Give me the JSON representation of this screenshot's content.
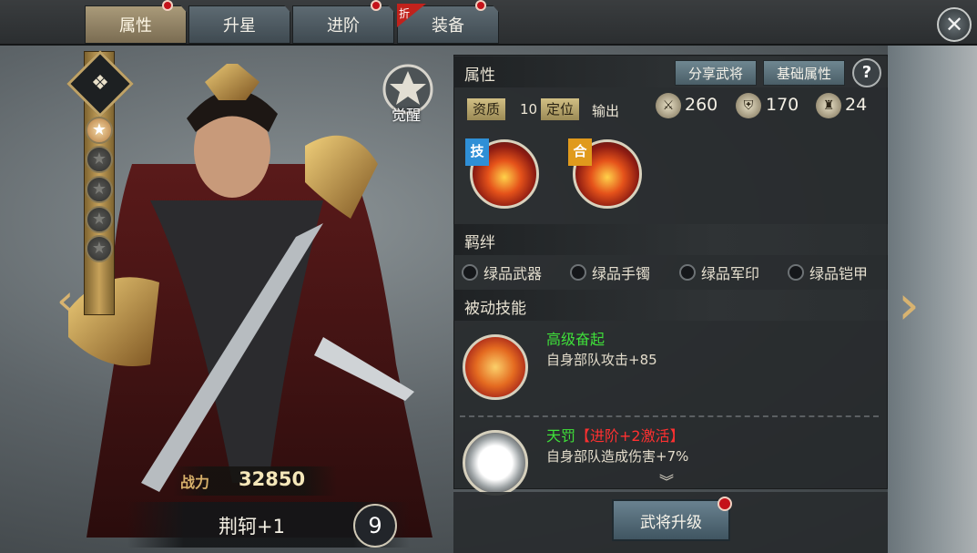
{
  "tabs": [
    {
      "label": "属性",
      "active": true,
      "has_alert": true
    },
    {
      "label": "升星",
      "active": false,
      "has_alert": false
    },
    {
      "label": "进阶",
      "active": false,
      "has_alert": true
    },
    {
      "label": "装备",
      "active": false,
      "has_alert": true,
      "sale_flag": "折"
    }
  ],
  "close_icon": "✕",
  "hero": {
    "awaken_label": "觉醒",
    "power_label": "战力",
    "power_value": "32850",
    "name": "荆轲+1",
    "level": "9",
    "stars_total": 5,
    "stars_lit": 1
  },
  "panel": {
    "attributes_title": "属性",
    "share_button": "分享武将",
    "base_attr_button": "基础属性",
    "help_button": "?",
    "aptitude_tag": "资质",
    "aptitude_value": "10",
    "position_tag": "定位",
    "position_value": "输出",
    "stats": [
      {
        "icon": "attack-icon",
        "value": "260"
      },
      {
        "icon": "defense-icon",
        "value": "170"
      },
      {
        "icon": "troops-icon",
        "value": "24"
      }
    ],
    "skills": [
      {
        "tag": "技",
        "tag_color": "#2f8fd6"
      },
      {
        "tag": "合",
        "tag_color": "#e09a1c"
      }
    ],
    "bonds_title": "羁绊",
    "bonds": [
      "绿品武器",
      "绿品手镯",
      "绿品军印",
      "绿品铠甲"
    ],
    "passive_title": "被动技能",
    "passives": [
      {
        "name": "高级奋起",
        "name_color": "#3fe03a",
        "desc": "自身部队攻击+85",
        "suffix": ""
      },
      {
        "name": "天罚",
        "name_color": "#3fe03a",
        "desc": "自身部队造成伤害+7%",
        "suffix": "【进阶+2激活】",
        "suffix_color": "#ff3030"
      }
    ],
    "more_icon": "︾",
    "upgrade_button": "武将升级"
  }
}
